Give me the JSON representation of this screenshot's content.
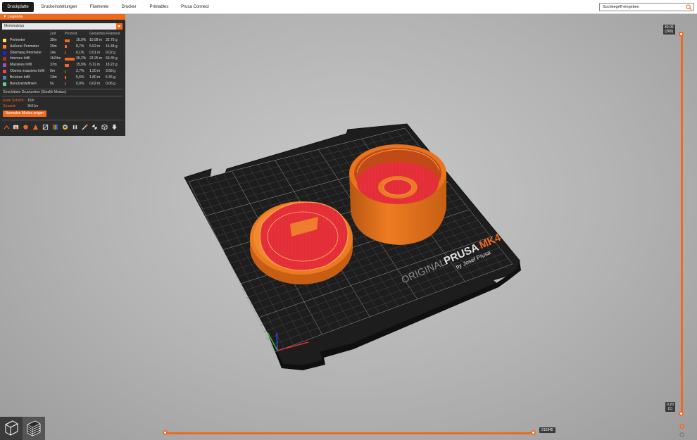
{
  "tabs": [
    {
      "label": "Druckplatte",
      "active": true
    },
    {
      "label": "Druckeinstellungen",
      "active": false
    },
    {
      "label": "Filamente",
      "active": false
    },
    {
      "label": "Drucker",
      "active": false
    },
    {
      "label": "Printables",
      "active": false
    },
    {
      "label": "Prusa Connect",
      "active": false
    }
  ],
  "search": {
    "placeholder": "Suchbegriff eingeben",
    "icon": "search-icon"
  },
  "legend": {
    "title": "Legende",
    "view_type": "Merkmalstyp",
    "columns": {
      "time": "Zeit",
      "percent": "Prozent",
      "used_filament": "Genutztes Filament"
    },
    "rows": [
      {
        "name": "Perimeter",
        "time": "39m",
        "percent": "16,9%",
        "fraction": 0.169,
        "length": "10.98 m",
        "weight": "32.75 g",
        "color": "#ffe64d"
      },
      {
        "name": "Äußerer Perimeter",
        "time": "20m",
        "percent": "8,7%",
        "fraction": 0.087,
        "length": "5.52 m",
        "weight": "16.48 g",
        "color": "#ff7d38"
      },
      {
        "name": "Überhang Perimeter",
        "time": "14s",
        "percent": "0,1%",
        "fraction": 0.001,
        "length": "0.01 m",
        "weight": "0.02 g",
        "color": "#1f1fff"
      },
      {
        "name": "Internes Infill",
        "time": "1h24m",
        "percent": "36,2%",
        "fraction": 0.362,
        "length": "23.25 m",
        "weight": "69.35 g",
        "color": "#b03029"
      },
      {
        "name": "Massives Infill",
        "time": "37m",
        "percent": "15,9%",
        "fraction": 0.159,
        "length": "6.11 m",
        "weight": "18.22 g",
        "color": "#9654cc"
      },
      {
        "name": "Oberes massives Infill",
        "time": "9m",
        "percent": "3,7%",
        "fraction": 0.037,
        "length": "1.20 m",
        "weight": "3.58 g",
        "color": "#f04040"
      },
      {
        "name": "Brücken Infill",
        "time": "13m",
        "percent": "5,6%",
        "fraction": 0.056,
        "length": "1.80 m",
        "weight": "5.35 g",
        "color": "#4d80ba"
      },
      {
        "name": "Benutzerdefiniert",
        "time": "5s",
        "percent": "0,0%",
        "fraction": 0.0,
        "length": "0.02 m",
        "weight": "0.06 g",
        "color": "#5ed194"
      }
    ],
    "estimated_title": "Geschätzte Druckzeiten [Stealth Modus]:",
    "first_layer_label": "Erste Schicht:",
    "first_layer_value": "15m",
    "total_label": "Gesamt:",
    "total_value": "3h51m",
    "normal_mode_button": "Normalen Modus zeigen"
  },
  "bed": {
    "brand_line1": "ORIGINAL",
    "brand_line2": "PRUSA",
    "model": "MK4",
    "maker": "by Josef Prusa"
  },
  "vertical_slider": {
    "top_height": "40.00",
    "top_layer": "(200)",
    "bottom_height": "0.20",
    "bottom_layer": "(1)"
  },
  "horizontal_slider": {
    "value": "215945"
  },
  "colors": {
    "accent": "#ed6b21",
    "part_orange": "#e9741c",
    "part_red": "#e8303a"
  }
}
